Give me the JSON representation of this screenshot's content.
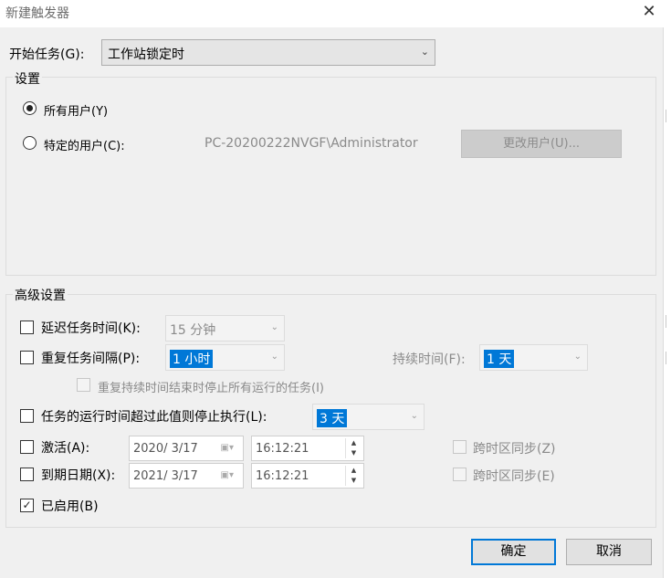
{
  "window": {
    "title": "新建触发器",
    "close_glyph": "✕"
  },
  "begin_task": {
    "label": "开始任务(G):",
    "value": "工作站锁定时",
    "arrow": "⌄"
  },
  "settings": {
    "title": "设置",
    "all_users_label": "所有用户(Y)",
    "all_users_selected": true,
    "specific_user_label": "特定的用户(C):",
    "user_name": "PC-20200222NVGF\\Administrator",
    "change_user_label": "更改用户(U)..."
  },
  "advanced": {
    "title": "高级设置",
    "delay": {
      "label": "延迟任务时间(K):",
      "value": "15 分钟",
      "checked": false
    },
    "repeat": {
      "label": "重复任务间隔(P):",
      "value": "1 小时",
      "checked": false
    },
    "duration": {
      "label": "持续时间(F):",
      "value": "1 天"
    },
    "stop_all": {
      "label": "重复持续时间结束时停止所有运行的任务(I)",
      "checked": false
    },
    "stop_longer": {
      "label": "任务的运行时间超过此值则停止执行(L):",
      "value": "3 天",
      "checked": false
    },
    "activate": {
      "label": "激活(A):",
      "date": "2020/ 3/17",
      "time": "16:12:21",
      "checked": false
    },
    "sync_tz_activate": {
      "label": "跨时区同步(Z)",
      "checked": false
    },
    "expire": {
      "label": "到期日期(X):",
      "date": "2021/ 3/17",
      "time": "16:12:21",
      "checked": false
    },
    "sync_tz_expire": {
      "label": "跨时区同步(E)",
      "checked": false
    },
    "enabled": {
      "label": "已启用(B)",
      "checked": true,
      "check_glyph": "✓"
    }
  },
  "icons": {
    "dropdown": "⌄",
    "calendar": "▣▾",
    "spin_up": "▲",
    "spin_down": "▼"
  },
  "buttons": {
    "ok_label": "确定",
    "cancel_label": "取消"
  },
  "colors": {
    "accent": "#0078d7",
    "background": "#f0f0f0"
  }
}
